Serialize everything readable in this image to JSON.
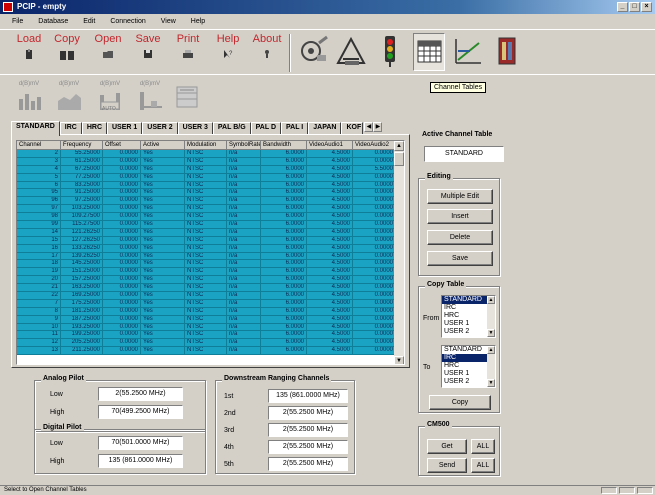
{
  "window": {
    "title": "PCIP - empty",
    "buttons": [
      "_",
      "□",
      "×"
    ]
  },
  "menu": [
    "File",
    "Database",
    "Edit",
    "Connection",
    "View",
    "Help"
  ],
  "toolbar": {
    "buttons": [
      {
        "label": "Load",
        "icon": "load-icon"
      },
      {
        "label": "Copy",
        "icon": "copy-icon"
      },
      {
        "label": "Open",
        "icon": "open-icon"
      },
      {
        "label": "Save",
        "icon": "save-icon"
      },
      {
        "label": "Print",
        "icon": "print-icon"
      },
      {
        "label": "Help",
        "icon": "help-icon"
      },
      {
        "label": "About",
        "icon": "about-icon"
      }
    ],
    "image_tools": [
      "settings-tools-icon",
      "level-meter-icon",
      "traffic-light-icon",
      "channel-tables-icon",
      "tilt-graph-icon",
      "cabinet-icon"
    ]
  },
  "tooltip": "Channel Tables",
  "toolbar2": {
    "tools": [
      {
        "label": "d(B)mV",
        "icon": "bar-chart-icon"
      },
      {
        "label": "d(B)mV",
        "icon": "area-chart-icon"
      },
      {
        "label": "d(B)mV",
        "icon": "auto-chart-icon",
        "badge": "AUTO"
      },
      {
        "label": "d(B)mV",
        "icon": "line-chart-icon"
      },
      {
        "label": "",
        "icon": "cabinet-disabled-icon"
      }
    ]
  },
  "tabs": [
    "STANDARD",
    "IRC",
    "HRC",
    "USER 1",
    "USER 2",
    "USER 3",
    "PAL B/G",
    "PAL D",
    "PAL I",
    "JAPAN",
    "KOF"
  ],
  "active_tab": "STANDARD",
  "grid": {
    "columns": [
      "Channel",
      "Frequency",
      "Offset",
      "Active",
      "Modulation",
      "SymbolRate",
      "Bandwidth",
      "VideoAudio1",
      "VideoAudio2"
    ],
    "rows": [
      [
        "2",
        "55.25000",
        "0.0000",
        "Yes",
        "NTSC",
        "n/a",
        "6.0000",
        "4.5000",
        "0.0000"
      ],
      [
        "3",
        "61.25000",
        "0.0000",
        "Yes",
        "NTSC",
        "n/a",
        "6.0000",
        "4.5000",
        "0.0000"
      ],
      [
        "4",
        "67.25000",
        "0.0000",
        "Yes",
        "NTSC",
        "n/a",
        "6.0000",
        "4.5000",
        "5.5000"
      ],
      [
        "5",
        "77.25000",
        "0.0000",
        "Yes",
        "NTSC",
        "n/a",
        "6.0000",
        "4.5000",
        "0.0000"
      ],
      [
        "6",
        "83.25000",
        "0.0000",
        "Yes",
        "NTSC",
        "n/a",
        "6.0000",
        "4.5000",
        "0.0000"
      ],
      [
        "95",
        "91.25000",
        "0.0000",
        "Yes",
        "NTSC",
        "n/a",
        "6.0000",
        "4.5000",
        "0.0000"
      ],
      [
        "96",
        "97.25000",
        "0.0000",
        "Yes",
        "NTSC",
        "n/a",
        "6.0000",
        "4.5000",
        "0.0000"
      ],
      [
        "97",
        "103.25000",
        "0.0000",
        "Yes",
        "NTSC",
        "n/a",
        "6.0000",
        "4.5000",
        "0.0000"
      ],
      [
        "98",
        "109.27500",
        "0.0000",
        "Yes",
        "NTSC",
        "n/a",
        "6.0000",
        "4.5000",
        "0.0000"
      ],
      [
        "99",
        "115.27500",
        "0.0000",
        "Yes",
        "NTSC",
        "n/a",
        "6.0000",
        "4.5000",
        "0.0000"
      ],
      [
        "14",
        "121.26250",
        "0.0000",
        "Yes",
        "NTSC",
        "n/a",
        "6.0000",
        "4.5000",
        "0.0000"
      ],
      [
        "15",
        "127.26250",
        "0.0000",
        "Yes",
        "NTSC",
        "n/a",
        "6.0000",
        "4.5000",
        "0.0000"
      ],
      [
        "16",
        "133.26250",
        "0.0000",
        "Yes",
        "NTSC",
        "n/a",
        "6.0000",
        "4.5000",
        "0.0000"
      ],
      [
        "17",
        "139.26250",
        "0.0000",
        "Yes",
        "NTSC",
        "n/a",
        "6.0000",
        "4.5000",
        "0.0000"
      ],
      [
        "18",
        "145.25000",
        "0.0000",
        "Yes",
        "NTSC",
        "n/a",
        "6.0000",
        "4.5000",
        "0.0000"
      ],
      [
        "19",
        "151.25000",
        "0.0000",
        "Yes",
        "NTSC",
        "n/a",
        "6.0000",
        "4.5000",
        "0.0000"
      ],
      [
        "20",
        "157.25000",
        "0.0000",
        "Yes",
        "NTSC",
        "n/a",
        "6.0000",
        "4.5000",
        "0.0000"
      ],
      [
        "21",
        "163.25000",
        "0.0000",
        "Yes",
        "NTSC",
        "n/a",
        "6.0000",
        "4.5000",
        "0.0000"
      ],
      [
        "22",
        "169.25000",
        "0.0000",
        "Yes",
        "NTSC",
        "n/a",
        "6.0000",
        "4.5000",
        "0.0000"
      ],
      [
        "7",
        "175.25000",
        "0.0000",
        "Yes",
        "NTSC",
        "n/a",
        "6.0000",
        "4.5000",
        "0.0000"
      ],
      [
        "8",
        "181.25000",
        "0.0000",
        "Yes",
        "NTSC",
        "n/a",
        "6.0000",
        "4.5000",
        "0.0000"
      ],
      [
        "9",
        "187.25000",
        "0.0000",
        "Yes",
        "NTSC",
        "n/a",
        "6.0000",
        "4.5000",
        "0.0000"
      ],
      [
        "10",
        "193.25000",
        "0.0000",
        "Yes",
        "NTSC",
        "n/a",
        "6.0000",
        "4.5000",
        "0.0000"
      ],
      [
        "11",
        "199.25000",
        "0.0000",
        "Yes",
        "NTSC",
        "n/a",
        "6.0000",
        "4.5000",
        "0.0000"
      ],
      [
        "12",
        "205.25000",
        "0.0000",
        "Yes",
        "NTSC",
        "n/a",
        "6.0000",
        "4.5000",
        "0.0000"
      ],
      [
        "13",
        "211.25000",
        "0.0000",
        "Yes",
        "NTSC",
        "n/a",
        "6.0000",
        "4.5000",
        "0.0000"
      ]
    ]
  },
  "analog_pilot": {
    "title": "Analog Pilot",
    "low_label": "Low",
    "low": "2(55.2500 MHz)",
    "high_label": "High",
    "high": "70(499.2500 MHz)"
  },
  "digital_pilot": {
    "title": "Digital Pilot",
    "low_label": "Low",
    "low": "70(501.0000 MHz)",
    "high_label": "High",
    "high": "135 (861.0000 MHz)"
  },
  "downstream": {
    "title": "Downstream Ranging Channels",
    "items": [
      {
        "label": "1st",
        "value": "135 (861.0000 MHz)"
      },
      {
        "label": "2nd",
        "value": "2(55.2500 MHz)"
      },
      {
        "label": "3rd",
        "value": "2(55.2500 MHz)"
      },
      {
        "label": "4th",
        "value": "2(55.2500 MHz)"
      },
      {
        "label": "5th",
        "value": "2(55.2500 MHz)"
      }
    ]
  },
  "active_channel_table": {
    "title": "Active Channel Table",
    "value": "STANDARD"
  },
  "editing": {
    "title": "Editing",
    "buttons": [
      "Multiple Edit",
      "Insert",
      "Delete",
      "Save"
    ]
  },
  "copy_table": {
    "title": "Copy Table",
    "from_label": "From",
    "from_items": [
      "STANDARD",
      "IRC",
      "HRC",
      "USER 1",
      "USER 2"
    ],
    "to_label": "To",
    "to_items": [
      "STANDARD",
      "IRC",
      "HRC",
      "USER 1",
      "USER 2"
    ],
    "copy_button": "Copy"
  },
  "cm500": {
    "title": "CM500",
    "get": "Get",
    "send": "Send",
    "all": "ALL"
  },
  "status": "Select to Open Channel Tables",
  "colors": {
    "grid_fill": "#1aa3c2",
    "toolbar_label": "#c1272d",
    "selection": "#0a246a"
  }
}
